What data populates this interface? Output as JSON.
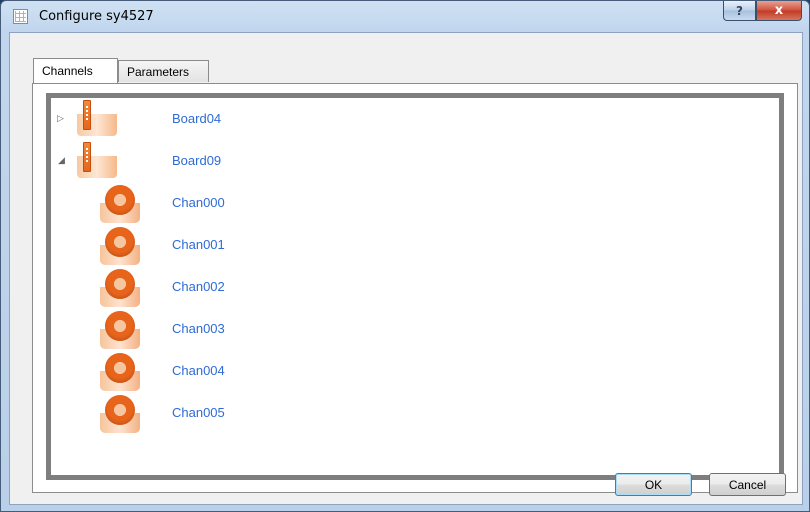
{
  "window": {
    "title": "Configure sy4527",
    "help_glyph": "?",
    "close_glyph": "x"
  },
  "tabs": [
    {
      "label": "Channels",
      "active": true
    },
    {
      "label": "Parameters",
      "active": false
    }
  ],
  "tree": {
    "boards": [
      {
        "label": "Board04",
        "expanded": false,
        "expander_glyph": "▷",
        "icon": "board-icon",
        "channels": []
      },
      {
        "label": "Board09",
        "expanded": true,
        "expander_glyph": "◢",
        "icon": "board-icon",
        "channels": [
          {
            "label": "Chan000",
            "icon": "channel-icon"
          },
          {
            "label": "Chan001",
            "icon": "channel-icon"
          },
          {
            "label": "Chan002",
            "icon": "channel-icon"
          },
          {
            "label": "Chan003",
            "icon": "channel-icon"
          },
          {
            "label": "Chan004",
            "icon": "channel-icon"
          },
          {
            "label": "Chan005",
            "icon": "channel-icon"
          }
        ]
      }
    ]
  },
  "buttons": {
    "ok_label": "OK",
    "cancel_label": "Cancel"
  },
  "colors": {
    "link_text": "#2e6bd6",
    "accent_orange": "#e8641b",
    "tree_border": "#7e7e7e"
  }
}
